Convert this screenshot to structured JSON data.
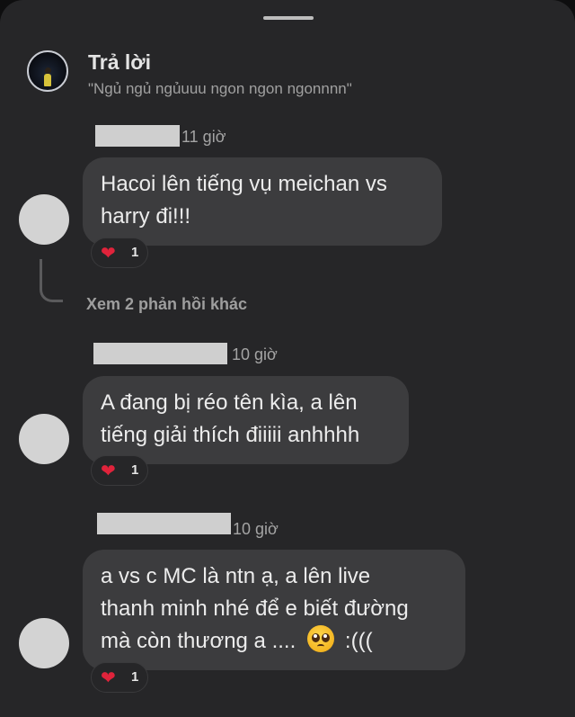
{
  "header": {
    "title": "Trả lời",
    "subtitle": "\"Ngủ ngủ ngủuuu ngon ngon ngonnnn\""
  },
  "more_replies": "Xem 2 phản hồi khác",
  "comments": [
    {
      "time": "11 giờ",
      "lines": [
        "Hacoi lên tiếng vụ meichan vs",
        "harry đi!!!"
      ],
      "reaction": {
        "icon": "heart-icon",
        "count": "1"
      }
    },
    {
      "time": "10 giờ",
      "lines": [
        "A đang bị réo tên kìa, a lên",
        "tiếng giải thích điiiii anhhhh"
      ],
      "reaction": {
        "icon": "heart-icon",
        "count": "1"
      }
    },
    {
      "time": "10 giờ",
      "lines": [
        "a vs c MC là ntn ạ, a lên live",
        "thanh minh nhé để e biết đường",
        "mà còn thương a ....",
        ":((("
      ],
      "emoji": "pleading-face-emoji",
      "reaction": {
        "icon": "heart-icon",
        "count": "1"
      }
    }
  ],
  "colors": {
    "background": "#262628",
    "bubble": "#3c3c3e",
    "heart": "#e0233b"
  }
}
